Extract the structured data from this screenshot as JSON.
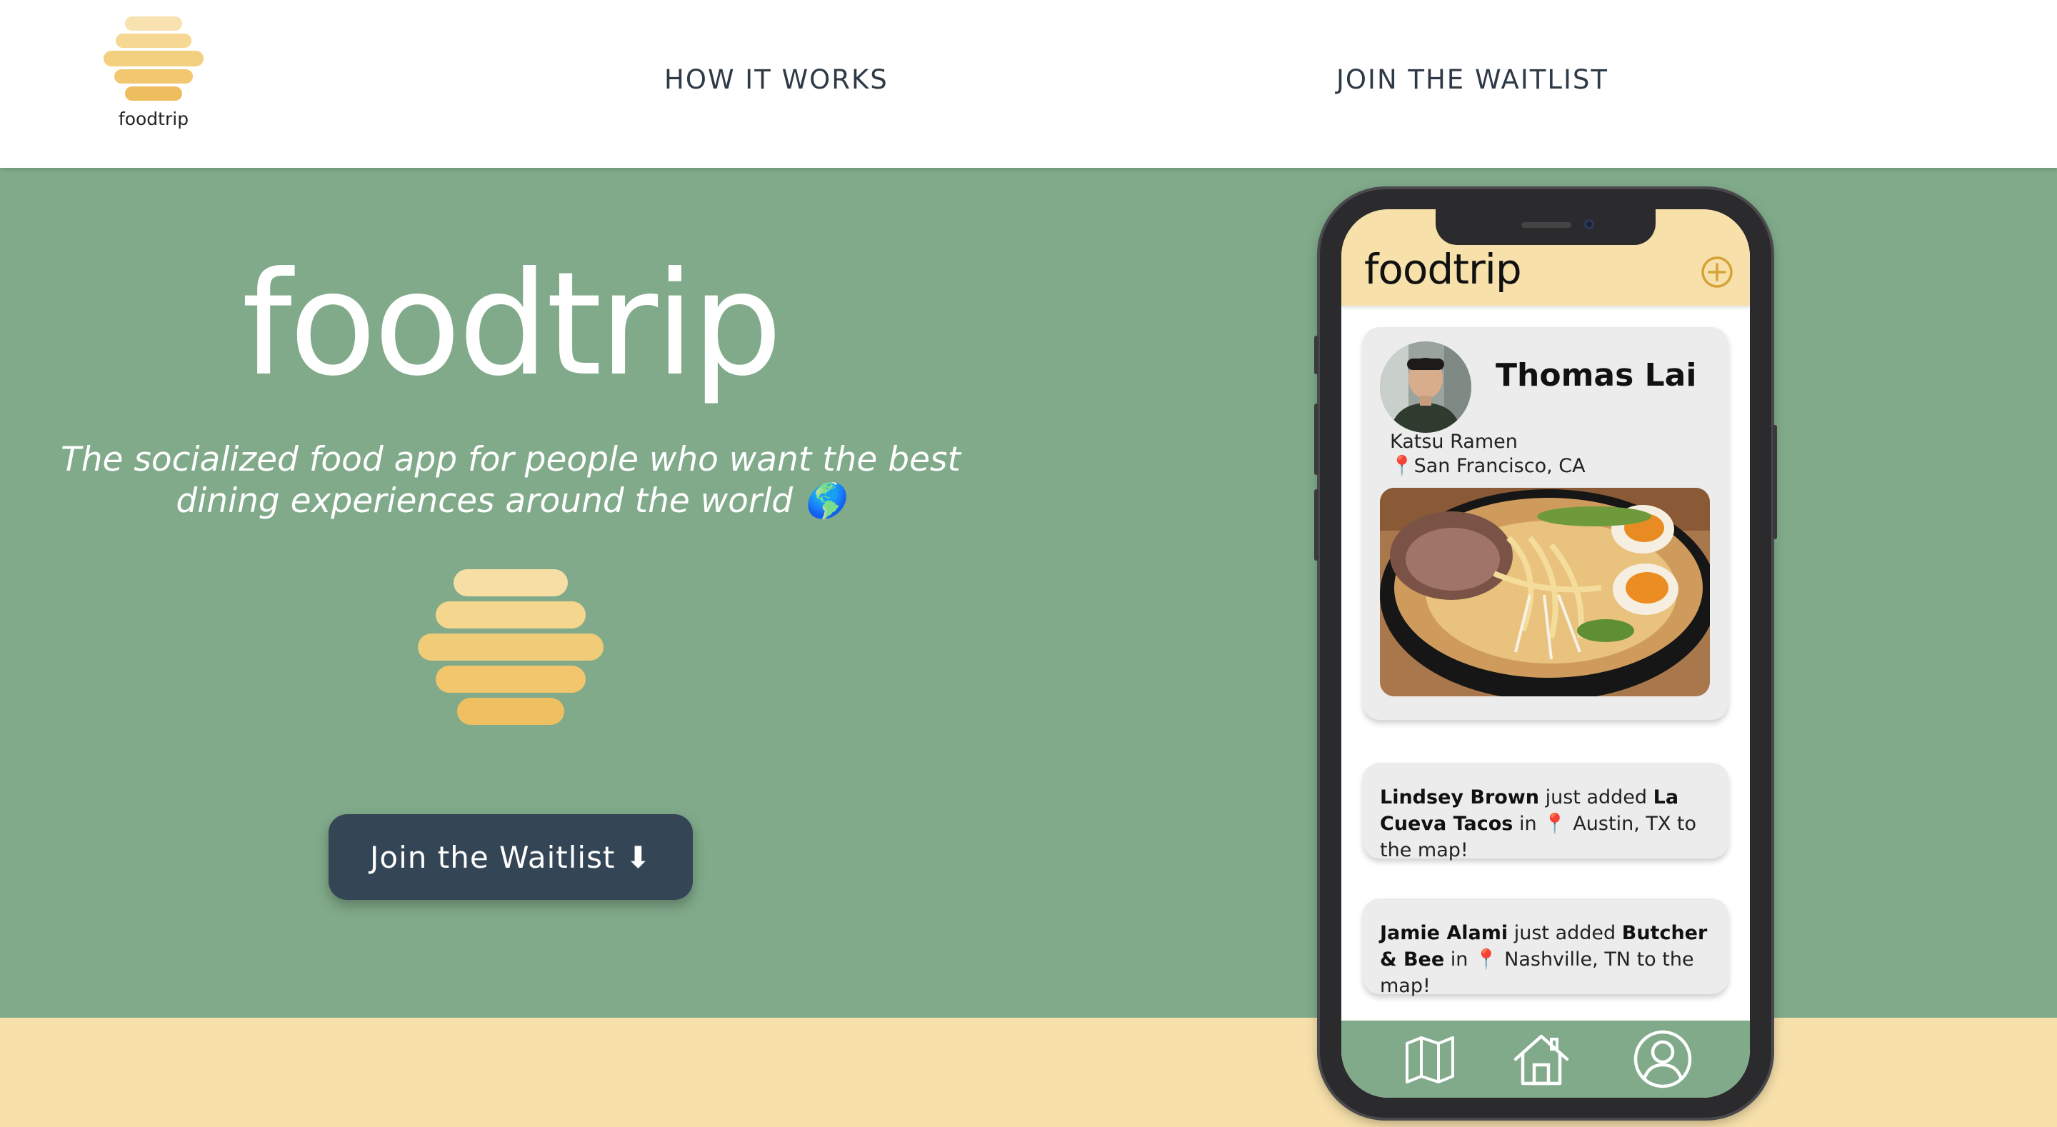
{
  "header": {
    "logo_text": "foodtrip",
    "nav": [
      {
        "label": "HOW IT WORKS"
      },
      {
        "label": "JOIN THE WAITLIST"
      }
    ]
  },
  "hero": {
    "title": "foodtrip",
    "tagline_line1": "The socialized food app for people who want the best",
    "tagline_line2": "dining experiences around the world 🌎",
    "cta_label": "Join the Waitlist ⬇"
  },
  "phone": {
    "app_title": "foodtrip",
    "post": {
      "user": "Thomas Lai",
      "restaurant": "Katsu Ramen",
      "location": "📍San Francisco, CA"
    },
    "activity": [
      {
        "user": "Lindsey Brown",
        "verb": " just added ",
        "place": "La Cueva Tacos",
        "connector": " in ",
        "location": "📍 Austin, TX to the map!"
      },
      {
        "user": "Jamie Alami",
        "verb": " just added ",
        "place": "Butcher & Bee",
        "connector": " in ",
        "location": "📍 Nashville, TN to the map!"
      }
    ],
    "tabs": [
      "map-icon",
      "home-icon",
      "profile-icon"
    ]
  },
  "colors": {
    "hero_green": "#80aa8a",
    "band_yellow": "#f7e0aa",
    "button_navy": "#344656",
    "honey_light": "#f6dea4",
    "honey_mid": "#f4d17e",
    "honey_dark": "#eec062"
  }
}
